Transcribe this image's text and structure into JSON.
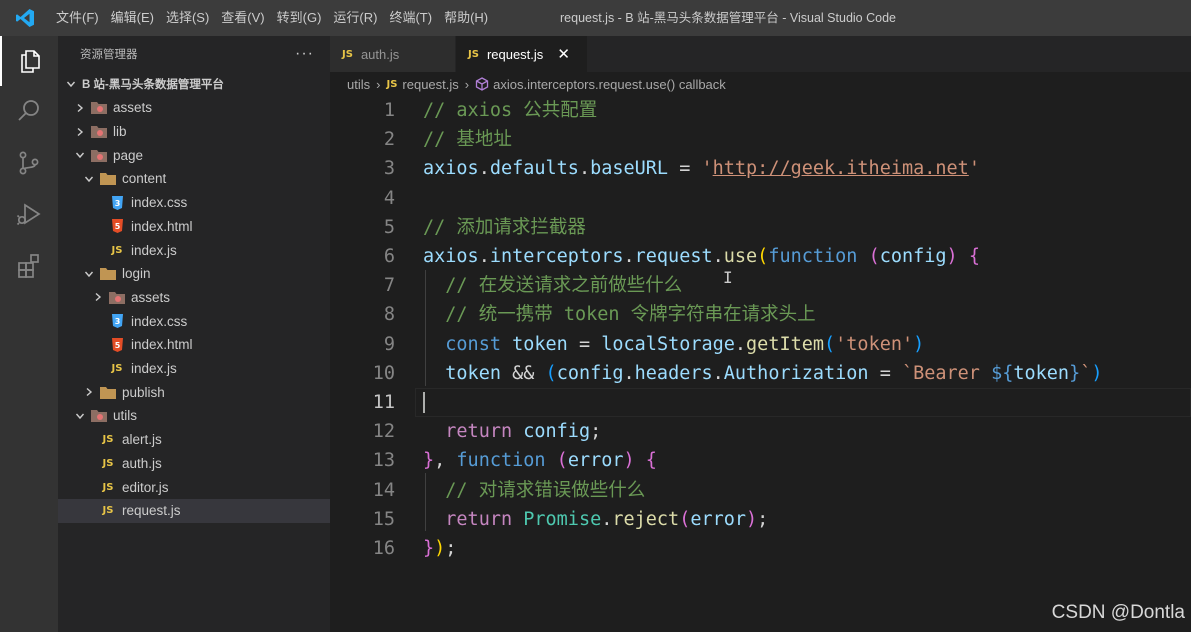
{
  "titlebar": {
    "menu": [
      "文件(F)",
      "编辑(E)",
      "选择(S)",
      "查看(V)",
      "转到(G)",
      "运行(R)",
      "终端(T)",
      "帮助(H)"
    ],
    "window_title": "request.js - B 站-黑马头条数据管理平台 - Visual Studio Code",
    "logo_color": "#23a9f2"
  },
  "activitybar": {
    "icons": [
      "explorer-icon",
      "search-icon",
      "source-control-icon",
      "run-debug-icon",
      "extensions-icon"
    ]
  },
  "sidebar": {
    "header": "资源管理器",
    "more": "···",
    "root": "B 站-黑马头条数据管理平台",
    "tree": [
      {
        "label": "assets",
        "kind": "folder-special",
        "expanded": false
      },
      {
        "label": "lib",
        "kind": "folder-special",
        "expanded": false
      },
      {
        "label": "page",
        "kind": "folder-special",
        "expanded": true
      },
      {
        "label": "content",
        "kind": "folder",
        "expanded": true
      },
      {
        "label": "index.css",
        "kind": "css"
      },
      {
        "label": "index.html",
        "kind": "html"
      },
      {
        "label": "index.js",
        "kind": "js"
      },
      {
        "label": "login",
        "kind": "folder",
        "expanded": true
      },
      {
        "label": "assets",
        "kind": "folder-special",
        "expanded": false
      },
      {
        "label": "index.css",
        "kind": "css"
      },
      {
        "label": "index.html",
        "kind": "html"
      },
      {
        "label": "index.js",
        "kind": "js"
      },
      {
        "label": "publish",
        "kind": "folder",
        "expanded": false
      },
      {
        "label": "utils",
        "kind": "folder-special",
        "expanded": true
      },
      {
        "label": "alert.js",
        "kind": "js"
      },
      {
        "label": "auth.js",
        "kind": "js"
      },
      {
        "label": "editor.js",
        "kind": "js"
      },
      {
        "label": "request.js",
        "kind": "js",
        "selected": true
      }
    ]
  },
  "tabs": [
    {
      "badge": "JS",
      "label": "auth.js",
      "active": false
    },
    {
      "badge": "JS",
      "label": "request.js",
      "active": true,
      "close": "✕"
    }
  ],
  "breadcrumb": {
    "folder": "utils",
    "badge": "JS",
    "file": "request.js",
    "symbol": "axios.interceptors.request.use() callback"
  },
  "editor": {
    "current_line": 11,
    "lines": [
      {
        "n": "1",
        "tokens": [
          [
            "cm",
            "// axios 公共配置"
          ]
        ]
      },
      {
        "n": "2",
        "tokens": [
          [
            "cm",
            "// 基地址"
          ]
        ]
      },
      {
        "n": "3",
        "tokens": [
          [
            "var",
            "axios"
          ],
          [
            "pl",
            "."
          ],
          [
            "var",
            "defaults"
          ],
          [
            "pl",
            "."
          ],
          [
            "var",
            "baseURL"
          ],
          [
            "pl",
            " = "
          ],
          [
            "str",
            "'"
          ],
          [
            "url",
            "http://geek.itheima.net"
          ],
          [
            "str",
            "'"
          ]
        ]
      },
      {
        "n": "4",
        "tokens": []
      },
      {
        "n": "5",
        "tokens": [
          [
            "cm",
            "// 添加请求拦截器"
          ]
        ]
      },
      {
        "n": "6",
        "tokens": [
          [
            "var",
            "axios"
          ],
          [
            "pl",
            "."
          ],
          [
            "var",
            "interceptors"
          ],
          [
            "pl",
            "."
          ],
          [
            "var",
            "request"
          ],
          [
            "pl",
            "."
          ],
          [
            "fn",
            "use"
          ],
          [
            "br1",
            "("
          ],
          [
            "kw",
            "function"
          ],
          [
            "pl",
            " "
          ],
          [
            "br2",
            "("
          ],
          [
            "var",
            "config"
          ],
          [
            "br2",
            ")"
          ],
          [
            "pl",
            " "
          ],
          [
            "br2",
            "{"
          ]
        ]
      },
      {
        "n": "7",
        "tokens": [
          [
            "pl",
            "  "
          ],
          [
            "cm",
            "// 在发送请求之前做些什么"
          ]
        ]
      },
      {
        "n": "8",
        "tokens": [
          [
            "pl",
            "  "
          ],
          [
            "cm",
            "// 统一携带 token 令牌字符串在请求头上"
          ]
        ]
      },
      {
        "n": "9",
        "tokens": [
          [
            "pl",
            "  "
          ],
          [
            "kw",
            "const"
          ],
          [
            "pl",
            " "
          ],
          [
            "var",
            "token"
          ],
          [
            "pl",
            " = "
          ],
          [
            "var",
            "localStorage"
          ],
          [
            "pl",
            "."
          ],
          [
            "fn",
            "getItem"
          ],
          [
            "br3",
            "("
          ],
          [
            "str",
            "'token'"
          ],
          [
            "br3",
            ")"
          ]
        ]
      },
      {
        "n": "10",
        "tokens": [
          [
            "pl",
            "  "
          ],
          [
            "var",
            "token"
          ],
          [
            "pl",
            " && "
          ],
          [
            "br3",
            "("
          ],
          [
            "var",
            "config"
          ],
          [
            "pl",
            "."
          ],
          [
            "var",
            "headers"
          ],
          [
            "pl",
            "."
          ],
          [
            "var",
            "Authorization"
          ],
          [
            "pl",
            " = "
          ],
          [
            "tpl",
            "`Bearer "
          ],
          [
            "tplx",
            "${"
          ],
          [
            "var",
            "token"
          ],
          [
            "tplx",
            "}"
          ],
          [
            "tpl",
            "`"
          ],
          [
            "br3",
            ")"
          ]
        ]
      },
      {
        "n": "11",
        "tokens": []
      },
      {
        "n": "12",
        "tokens": [
          [
            "pl",
            "  "
          ],
          [
            "kw2",
            "return"
          ],
          [
            "pl",
            " "
          ],
          [
            "var",
            "config"
          ],
          [
            "pl",
            ";"
          ]
        ]
      },
      {
        "n": "13",
        "tokens": [
          [
            "br2",
            "}"
          ],
          [
            "pl",
            ", "
          ],
          [
            "kw",
            "function"
          ],
          [
            "pl",
            " "
          ],
          [
            "br2",
            "("
          ],
          [
            "var",
            "error"
          ],
          [
            "br2",
            ")"
          ],
          [
            "pl",
            " "
          ],
          [
            "br2",
            "{"
          ]
        ]
      },
      {
        "n": "14",
        "tokens": [
          [
            "pl",
            "  "
          ],
          [
            "cm",
            "// 对请求错误做些什么"
          ]
        ]
      },
      {
        "n": "15",
        "tokens": [
          [
            "pl",
            "  "
          ],
          [
            "kw2",
            "return"
          ],
          [
            "pl",
            " "
          ],
          [
            "cls",
            "Promise"
          ],
          [
            "pl",
            "."
          ],
          [
            "fn",
            "reject"
          ],
          [
            "br2",
            "("
          ],
          [
            "var",
            "error"
          ],
          [
            "br2",
            ")"
          ],
          [
            "pl",
            ";"
          ]
        ]
      },
      {
        "n": "16",
        "tokens": [
          [
            "br2",
            "}"
          ],
          [
            "br1",
            ")"
          ],
          [
            "pl",
            ";"
          ]
        ]
      }
    ]
  },
  "watermark": "CSDN @Dontla",
  "mouse_cursor": "I"
}
